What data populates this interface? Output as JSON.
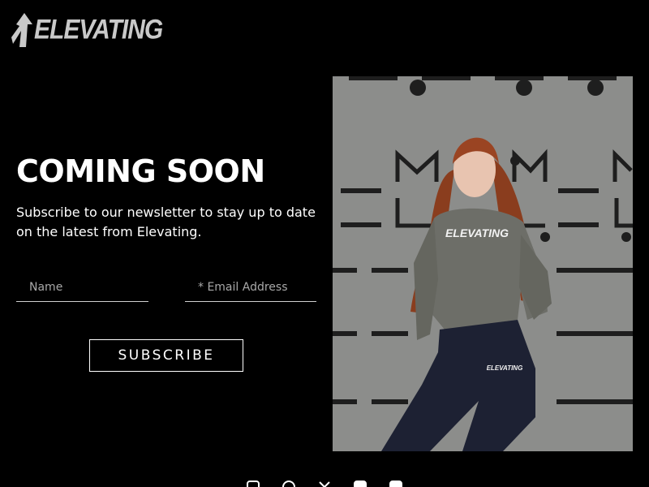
{
  "brand": {
    "name": "ELEVATING"
  },
  "hero": {
    "heading": "COMING SOON",
    "subtext": "Subscribe to our newsletter to stay up to date on the latest from Elevating."
  },
  "form": {
    "name_placeholder": "Name",
    "email_placeholder": "* Email Address",
    "submit_label": "SUBSCRIBE"
  },
  "photo": {
    "hoodie_print": "ELEVATING",
    "pants_print": "ELEVATING"
  },
  "social": {
    "icons": [
      "instagram-icon",
      "pinterest-icon",
      "x-icon",
      "facebook-icon",
      "linkedin-icon"
    ]
  },
  "colors": {
    "background": "#000000",
    "text": "#ffffff",
    "placeholder": "#a8a8a8",
    "logo": "#c9c9c9"
  }
}
